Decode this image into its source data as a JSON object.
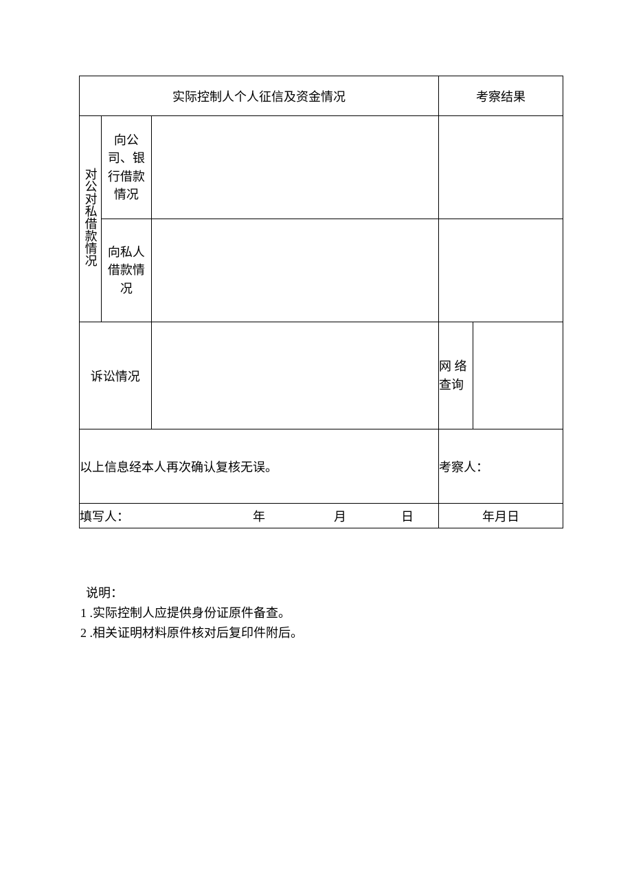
{
  "table": {
    "title": "实际控制人个人征信及资金情况",
    "result_header": "考察结果",
    "loan_group": "对公对私借款情况",
    "loan_to_company": "向公司、银行借款情况",
    "loan_to_private": "向私人借款情况",
    "litigation": "诉讼情况",
    "net_query": "网 络查询",
    "confirm_text": "以上信息经本人再次确认复核无误。",
    "inspector": "考察人：",
    "signer_label": "填写人：",
    "year": "年",
    "month": "月",
    "day": "日",
    "date_compact": "年月日"
  },
  "notes": {
    "heading": "说明：",
    "item1_num": "1 .",
    "item1_text": "实际控制人应提供身份证原件备查。",
    "item2_num": "2 .",
    "item2_text": "相关证明材料原件核对后复印件附后。"
  }
}
